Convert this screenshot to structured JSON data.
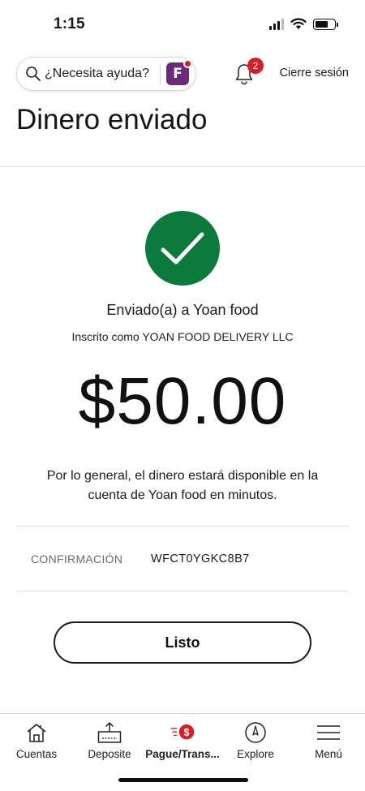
{
  "status_bar": {
    "time": "1:15"
  },
  "header": {
    "search_placeholder": "¿Necesita ayuda?",
    "notification_count": "2",
    "logout_label": "Cierre sesión",
    "assistant_letter": "F"
  },
  "page": {
    "title": "Dinero enviado"
  },
  "receipt": {
    "sent_to": "Enviado(a) a Yoan food",
    "enrolled_as": "Inscrito como YOAN FOOD DELIVERY LLC",
    "amount": "$50.00",
    "availability_note": "Por lo general, el dinero estará disponible en la cuenta de Yoan food en minutos.",
    "confirmation_label": "CONFIRMACIÓN",
    "confirmation_code": "WFCT0YGKC8B7"
  },
  "actions": {
    "done_label": "Listo"
  },
  "bottom_nav": {
    "items": [
      {
        "label": "Cuentas",
        "icon": "house-icon"
      },
      {
        "label": "Deposite",
        "icon": "deposit-icon"
      },
      {
        "label": "Pague/Trans...",
        "icon": "pay-transfer-icon",
        "active": true
      },
      {
        "label": "Explore",
        "icon": "compass-icon"
      },
      {
        "label": "Menú",
        "icon": "menu-icon"
      }
    ]
  },
  "colors": {
    "success": "#0c7a3c",
    "brand_red": "#d71e28",
    "brand_purple": "#6b2a7a"
  }
}
